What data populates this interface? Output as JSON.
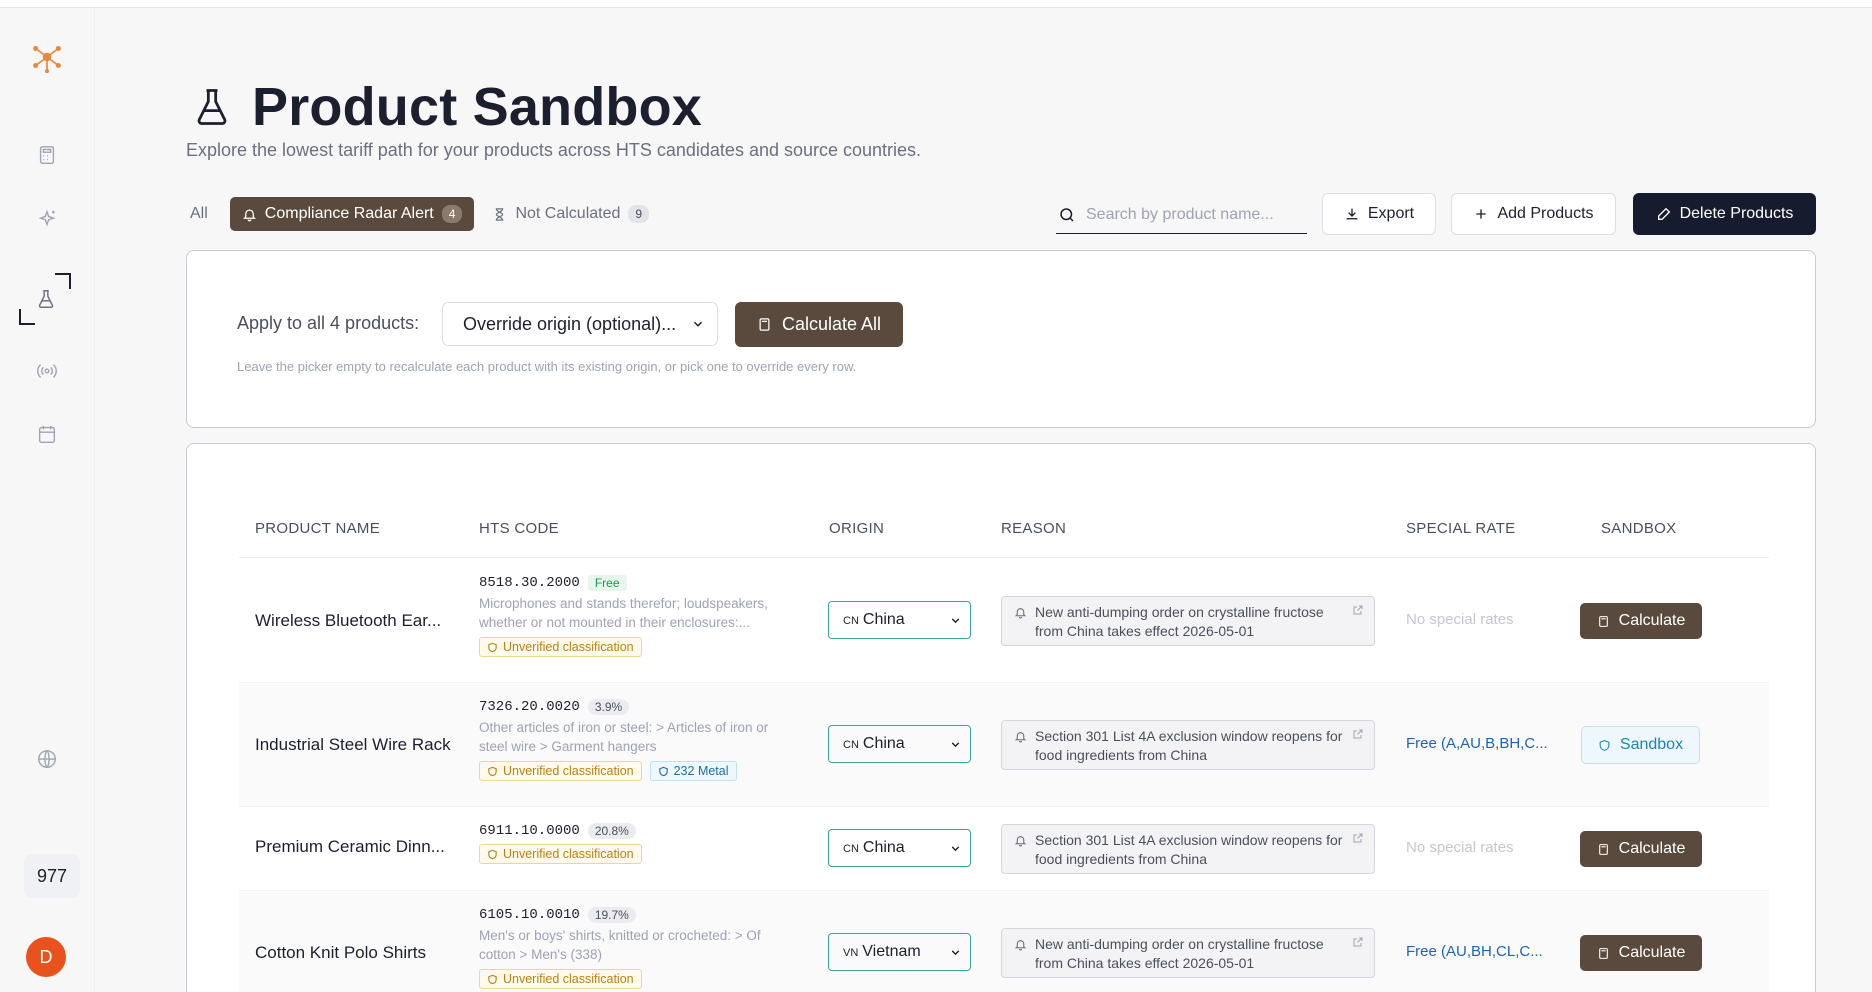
{
  "header": {
    "title": "Product Sandbox",
    "subtitle": "Explore the lowest tariff path for your products across HTS candidates and source countries."
  },
  "filters": {
    "all_label": "All",
    "radar_label": "Compliance Radar Alert",
    "radar_count": "4",
    "notcalc_label": "Not Calculated",
    "notcalc_count": "9"
  },
  "search": {
    "placeholder": "Search by product name..."
  },
  "toolbar": {
    "export_label": "Export",
    "add_label": "Add Products",
    "delete_label": "Delete Products"
  },
  "apply": {
    "label": "Apply to all 4 products:",
    "select_value": "Override origin (optional)...",
    "calc_all_label": "Calculate All",
    "hint": "Leave the picker empty to recalculate each product with its existing origin, or pick one to override every row."
  },
  "table": {
    "headers": [
      "PRODUCT NAME",
      "HTS CODE",
      "ORIGIN",
      "REASON",
      "SPECIAL RATE",
      "SANDBOX"
    ],
    "rows": [
      {
        "name": "Wireless Bluetooth Ear...",
        "hts_code": "8518.30.2000",
        "rate": "Free",
        "desc": "Microphones and stands therefor; loudspeakers, whether or not mounted in their enclosures:...",
        "tag": "Unverified classification",
        "tag2": "",
        "origin_cc": "CN",
        "origin": "China",
        "reason": "New anti-dumping order on crystalline fructose from China takes effect 2026-05-01",
        "special": "No special rates",
        "action": "Calculate"
      },
      {
        "name": "Industrial Steel Wire Rack",
        "hts_code": "7326.20.0020",
        "rate": "3.9%",
        "desc": "Other articles of iron or steel: > Articles of iron or steel wire > Garment hangers",
        "tag": "Unverified classification",
        "tag2": "232 Metal",
        "origin_cc": "CN",
        "origin": "China",
        "reason": "Section 301 List 4A exclusion window reopens for food ingredients from China",
        "special": "Free (A,AU,B,BH,C...",
        "action": "Sandbox"
      },
      {
        "name": "Premium Ceramic Dinn...",
        "hts_code": "6911.10.0000",
        "rate": "20.8%",
        "desc": "",
        "tag": "Unverified classification",
        "tag2": "",
        "origin_cc": "CN",
        "origin": "China",
        "reason": "Section 301 List 4A exclusion window reopens for food ingredients from China",
        "special": "No special rates",
        "action": "Calculate"
      },
      {
        "name": "Cotton Knit Polo Shirts",
        "hts_code": "6105.10.0010",
        "rate": "19.7%",
        "desc": "Men's or boys' shirts, knitted or crocheted: > Of cotton > Men's (338)",
        "tag": "Unverified classification",
        "tag2": "",
        "origin_cc": "VN",
        "origin": "Vietnam",
        "reason": "New anti-dumping order on crystalline fructose from China takes effect 2026-05-01",
        "special": "Free (AU,BH,CL,C...",
        "action": "Calculate"
      }
    ]
  },
  "sidebar": {
    "counter": "977",
    "avatar_initial": "D"
  },
  "colors": {
    "accent_brown": "#5a4a3d",
    "dark": "#161b2e",
    "link_blue": "#1d63b8",
    "avatar_orange": "#e8531d"
  }
}
